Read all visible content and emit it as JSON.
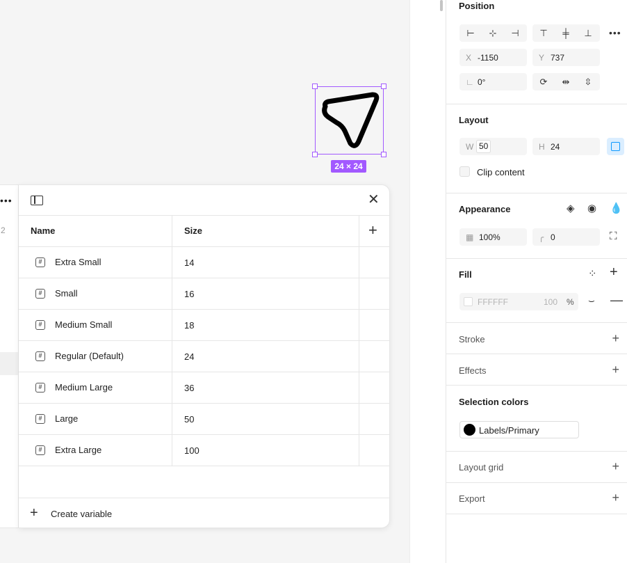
{
  "canvas": {
    "size_badge": "24 × 24"
  },
  "variables_table": {
    "left_count": "2",
    "columns": {
      "name": "Name",
      "size": "Size"
    },
    "rows": [
      {
        "name": "Extra Small",
        "value": "14"
      },
      {
        "name": "Small",
        "value": "16"
      },
      {
        "name": "Medium Small",
        "value": "18"
      },
      {
        "name": "Regular (Default)",
        "value": "24"
      },
      {
        "name": "Medium Large",
        "value": "36"
      },
      {
        "name": "Large",
        "value": "50"
      },
      {
        "name": "Extra Large",
        "value": "100"
      }
    ],
    "create_label": "Create variable"
  },
  "properties": {
    "position": {
      "title": "Position",
      "x_label": "X",
      "x_value": "-1150",
      "y_label": "Y",
      "y_value": "737",
      "rotation_value": "0°"
    },
    "layout": {
      "title": "Layout",
      "w_label": "W",
      "w_value": "50",
      "h_label": "H",
      "h_value": "24",
      "clip_label": "Clip content"
    },
    "appearance": {
      "title": "Appearance",
      "opacity": "100%",
      "radius": "0"
    },
    "fill": {
      "title": "Fill",
      "hex": "FFFFFF",
      "opacity": "100",
      "percent": "%"
    },
    "stroke": {
      "title": "Stroke"
    },
    "effects": {
      "title": "Effects"
    },
    "selection_colors": {
      "title": "Selection colors",
      "color_name": "Labels/Primary",
      "swatch": "#000000"
    },
    "layout_grid": {
      "title": "Layout grid"
    },
    "export": {
      "title": "Export"
    }
  },
  "colors": {
    "selection": "#a259ff",
    "accent_blue": "#0d99ff"
  }
}
